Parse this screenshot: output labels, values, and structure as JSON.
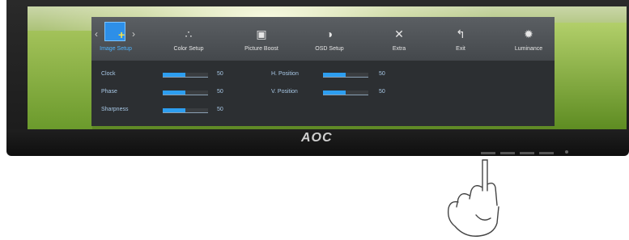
{
  "monitor": {
    "brand": "AOC"
  },
  "osd": {
    "menu": [
      {
        "label": "Image Setup",
        "icon": "image-setup-icon",
        "active": true
      },
      {
        "label": "Color Setup",
        "icon": "color-setup-icon"
      },
      {
        "label": "Picture Boost",
        "icon": "picture-boost-icon"
      },
      {
        "label": "OSD Setup",
        "icon": "osd-setup-icon"
      },
      {
        "label": "Extra",
        "icon": "extra-icon"
      },
      {
        "label": "Exit",
        "icon": "exit-icon"
      },
      {
        "label": "Luminance",
        "icon": "luminance-icon"
      }
    ],
    "left_settings": [
      {
        "name": "Clock",
        "value": "50",
        "level": 0.5
      },
      {
        "name": "Phase",
        "value": "50",
        "level": 0.5
      },
      {
        "name": "Sharpness",
        "value": "50",
        "level": 0.5
      }
    ],
    "right_settings": [
      {
        "name": "H. Position",
        "value": "50",
        "level": 0.5
      },
      {
        "name": "V. Position",
        "value": "50",
        "level": 0.5
      }
    ]
  },
  "colors": {
    "accent": "#2d9ef0",
    "osd_bg": "#2c2f32"
  }
}
